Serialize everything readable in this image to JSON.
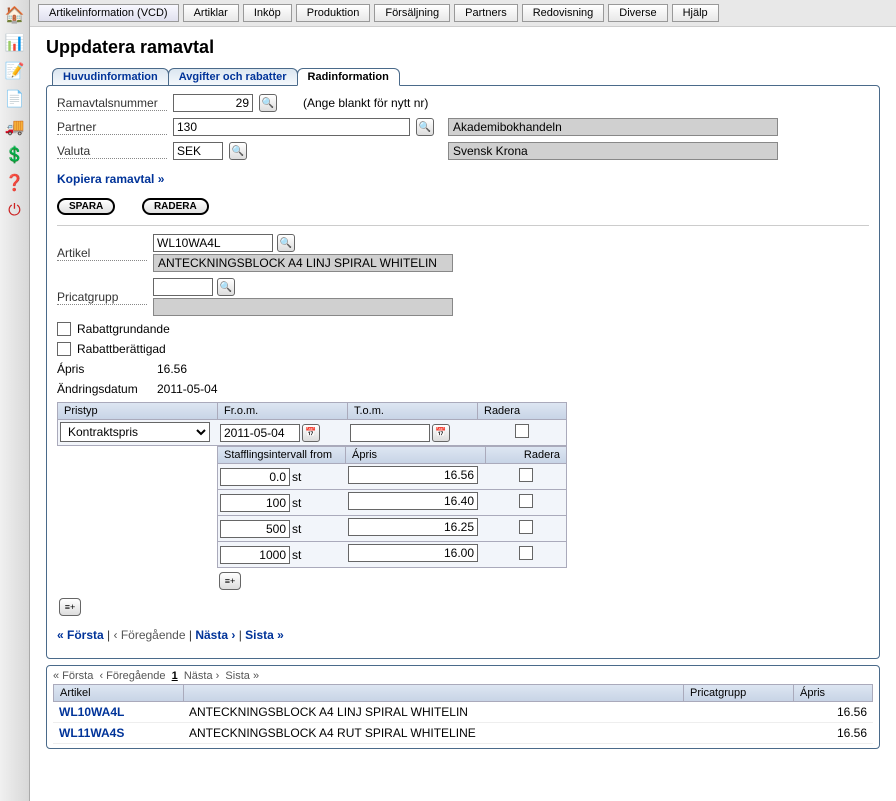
{
  "top_menu": [
    "Artikelinformation (VCD)",
    "Artiklar",
    "Inköp",
    "Produktion",
    "Försäljning",
    "Partners",
    "Redovisning",
    "Diverse",
    "Hjälp"
  ],
  "page_title": "Uppdatera ramavtal",
  "tabs": [
    "Huvudinformation",
    "Avgifter och rabatter",
    "Radinformation"
  ],
  "labels": {
    "ramavtal": "Ramavtalsnummer",
    "partner": "Partner",
    "valuta": "Valuta",
    "blank_note": "(Ange blankt för nytt nr)",
    "kopiera": "Kopiera ramavtal »",
    "spara": "SPARA",
    "radera": "RADERA",
    "artikel": "Artikel",
    "pricatgrupp": "Pricatgrupp",
    "rabattgrundande": "Rabattgrundande",
    "rabattberattigad": "Rabattberättigad",
    "apris": "Ápris",
    "andringsdatum": "Ändringsdatum",
    "pristyp": "Pristyp",
    "from": "Fr.o.m.",
    "tom": "T.o.m.",
    "radera_col": "Radera",
    "staffling": "Stafflingsintervall from",
    "apris_col": "Ápris",
    "unit": "st"
  },
  "values": {
    "ramavtal": "29",
    "partner_id": "130",
    "partner_name": "Akademibokhandeln",
    "valuta_code": "SEK",
    "valuta_name": "Svensk Krona",
    "artikel_code": "WL10WA4L",
    "artikel_name": "ANTECKNINGSBLOCK A4 LINJ SPIRAL WHITELIN",
    "pricatgrupp_code": "",
    "pricatgrupp_name": "",
    "apris_val": "16.56",
    "andringsdatum_val": "2011-05-04",
    "pristyp_selected": "Kontraktspris",
    "from_date": "2011-05-04",
    "tom_date": ""
  },
  "tiers": [
    {
      "from": "0.0",
      "price": "16.56"
    },
    {
      "from": "100",
      "price": "16.40"
    },
    {
      "from": "500",
      "price": "16.25"
    },
    {
      "from": "1000",
      "price": "16.00"
    }
  ],
  "pager": {
    "first": "« Första",
    "prev": "‹ Föregående",
    "next": "Nästa ›",
    "last": "Sista »"
  },
  "pager2_text": "« Första  ‹ Föregående  1  Nästa ›  Sista »",
  "bottom_headers": [
    "Artikel",
    "",
    "Pricatgrupp",
    "Ápris"
  ],
  "bottom_rows": [
    {
      "code": "WL10WA4L",
      "desc": "ANTECKNINGSBLOCK A4 LINJ SPIRAL WHITELIN",
      "pg": "",
      "price": "16.56"
    },
    {
      "code": "WL11WA4S",
      "desc": "ANTECKNINGSBLOCK A4 RUT SPIRAL WHITELINE",
      "pg": "",
      "price": "16.56"
    }
  ]
}
